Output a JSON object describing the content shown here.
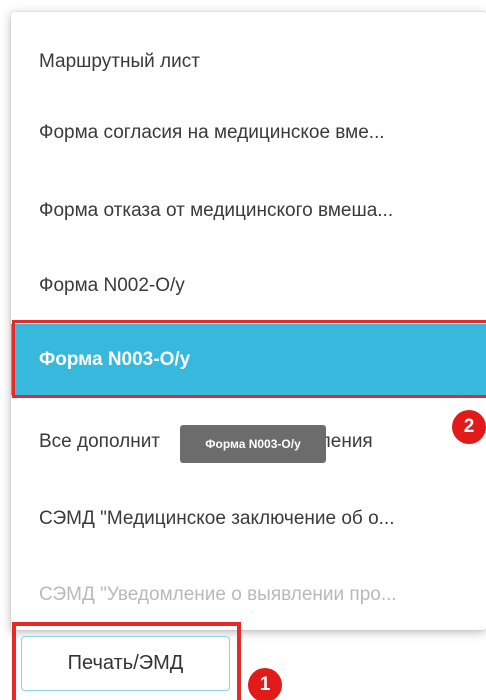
{
  "menu": {
    "items": [
      {
        "label": "Маршрутный лист",
        "state": "normal"
      },
      {
        "label": "Форма согласия на медицинское вме...",
        "state": "normal"
      },
      {
        "label": "Форма отказа от медицинского вмеша...",
        "state": "normal"
      },
      {
        "label": "Форма N002-О/у",
        "state": "normal"
      },
      {
        "label": "Форма N003-О/у",
        "state": "active"
      },
      {
        "label": "Все дополнит[скрыто подсказкой]вления",
        "visible_start": "Все дополнит",
        "visible_end": "вления",
        "state": "normal"
      },
      {
        "label": "СЭМД \"Медицинское заключение об о...",
        "state": "normal"
      },
      {
        "label": "СЭМД \"Уведомление о выявлении про...",
        "state": "disabled"
      }
    ]
  },
  "tooltip": {
    "text": "Форма N003-О/у"
  },
  "print_button": {
    "label": "Печать/ЭМД"
  },
  "badges": {
    "step1": "1",
    "step2": "2"
  },
  "colors": {
    "active_item_bg": "#36b9dc",
    "highlight_red": "#e22c2c",
    "badge_red": "#e21a1a",
    "tooltip_bg": "#6c6c6c",
    "disabled_text": "#b9b9b9",
    "button_border": "#8fd3e8"
  }
}
